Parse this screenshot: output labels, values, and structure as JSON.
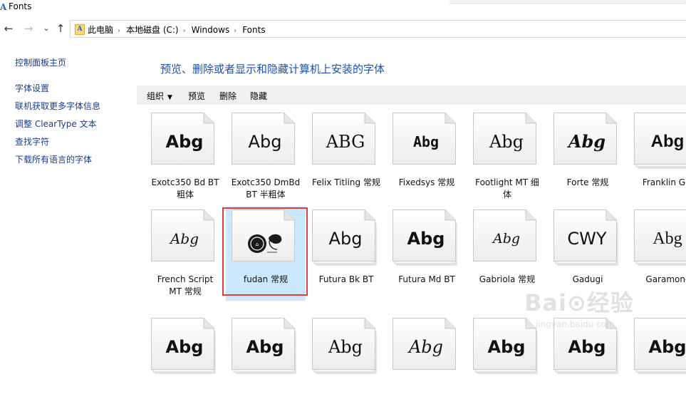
{
  "window": {
    "title": "Fonts"
  },
  "nav": {
    "back_icon": "←",
    "forward_icon": "→",
    "recent_icon": "⌄",
    "up_icon": "↑"
  },
  "address": {
    "crumbs": [
      "此电脑",
      "本地磁盘 (C:)",
      "Windows",
      "Fonts"
    ],
    "separator": "›"
  },
  "leftnav": {
    "items": [
      "控制面板主页",
      "字体设置",
      "联机获取更多字体信息",
      "调整 ClearType 文本",
      "查找字符",
      "下载所有语言的字体"
    ]
  },
  "main": {
    "heading": "预览、删除或者显示和隐藏计算机上安装的字体"
  },
  "toolbar": {
    "organize": "组织",
    "organize_caret": "▼",
    "preview": "预览",
    "delete": "删除",
    "hide": "隐藏"
  },
  "fonts": [
    {
      "label1": "Exotc350 Bd BT",
      "label2": "粗体",
      "sample": "Abg",
      "stack": false
    },
    {
      "label1": "Exotc350 DmBd",
      "label2": "BT 半粗体",
      "sample": "Abg",
      "stack": false
    },
    {
      "label1": "Felix Titling 常规",
      "label2": "",
      "sample": "ABG",
      "stack": false
    },
    {
      "label1": "Fixedsys 常规",
      "label2": "",
      "sample": "Abg",
      "stack": false
    },
    {
      "label1": "Footlight MT 细",
      "label2": "体",
      "sample": "Abg",
      "stack": false
    },
    {
      "label1": "Forte 常规",
      "label2": "",
      "sample": "Abg",
      "stack": false
    },
    {
      "label1": "Franklin Got",
      "label2": "",
      "sample": "Abg",
      "stack": true
    },
    {
      "label1": "French Script",
      "label2": "MT 常规",
      "sample": "Abg",
      "stack": false
    },
    {
      "label1": "fudan 常规",
      "label2": "",
      "sample": "",
      "stack": false
    },
    {
      "label1": "Futura Bk BT",
      "label2": "",
      "sample": "Abg",
      "stack": true
    },
    {
      "label1": "Futura Md BT",
      "label2": "",
      "sample": "Abg",
      "stack": true
    },
    {
      "label1": "Gabriola 常规",
      "label2": "",
      "sample": "Abg",
      "stack": false
    },
    {
      "label1": "Gadugi",
      "label2": "",
      "sample": "CWY",
      "stack": true
    },
    {
      "label1": "Garamond",
      "label2": "",
      "sample": "Abg",
      "stack": true
    },
    {
      "label1": "",
      "label2": "",
      "sample": "Abg",
      "stack": true
    },
    {
      "label1": "",
      "label2": "",
      "sample": "Abg",
      "stack": true
    },
    {
      "label1": "",
      "label2": "",
      "sample": "Abg",
      "stack": true
    },
    {
      "label1": "",
      "label2": "",
      "sample": "Abg",
      "stack": false
    },
    {
      "label1": "",
      "label2": "",
      "sample": "Abg",
      "stack": true
    },
    {
      "label1": "",
      "label2": "",
      "sample": "Abg",
      "stack": true
    },
    {
      "label1": "",
      "label2": "",
      "sample": "Abg",
      "stack": true
    }
  ],
  "selected_font": "fudan 常规",
  "colors": {
    "link": "#1a3c8c",
    "heading": "#1f4fb0",
    "selection": "#cce8ff",
    "highlight": "#e23d3d"
  },
  "watermark": {
    "logo": "Bai⊙经验",
    "url": "jingyan.baidu.com"
  }
}
